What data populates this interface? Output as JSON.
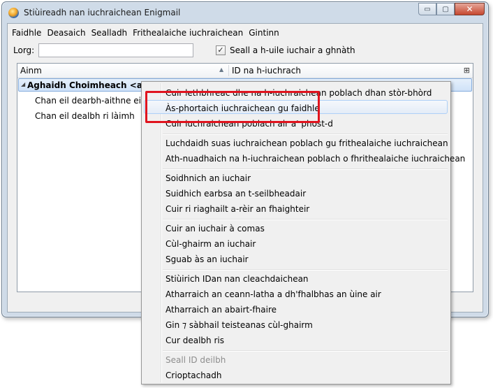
{
  "window": {
    "title": "Stiùireadh nan iuchraichean Enigmail",
    "buttons": {
      "minimize": "▭",
      "maximize": "▢",
      "close": "✕"
    }
  },
  "menubar": {
    "items": [
      {
        "label": "Faidhle"
      },
      {
        "label": "Deasaich"
      },
      {
        "label": "Sealladh"
      },
      {
        "label": "Frithealaiche iuchraichean"
      },
      {
        "label": "Gintinn"
      }
    ]
  },
  "search": {
    "label": "Lorg:",
    "value": "",
    "icon": "search-icon"
  },
  "show_all": {
    "checked": true,
    "check_glyph": "✓",
    "label": "Seall a h-uile iuchair a ghnàth"
  },
  "tree": {
    "columns": [
      {
        "label": "Ainm"
      },
      {
        "label": "ID na h-iuchrach"
      }
    ],
    "column_picker_glyph": "⊞",
    "rows": [
      {
        "text": "Aghaidh Choimheach <aghaidh",
        "expanded": true,
        "twisty": "◢"
      },
      {
        "text": "Chan eil dearbh-aithne eile aig"
      },
      {
        "text": "Chan eil dealbh ri làimh"
      }
    ]
  },
  "context_menu": {
    "groups": [
      [
        {
          "label": "Cuir lethbhreac dhe na h-iuchraichean poblach dhan stòr-bhòrd"
        },
        {
          "label": "Às-phortaich iuchraichean gu faidhle",
          "highlighted": true
        },
        {
          "label": "Cuir iuchraichean poblach air a' phost-d"
        }
      ],
      [
        {
          "label": "Luchdaidh suas iuchraichean poblach gu frithealaiche iuchraichean"
        },
        {
          "label": "Ath-nuadhaich na h-iuchraichean poblach o fhrithealaiche iuchraichean"
        }
      ],
      [
        {
          "label": "Soidhnich an iuchair"
        },
        {
          "label": "Suidhich earbsa an t-seilbheadair"
        },
        {
          "label": "Cuir ri riaghailt a-rèir an fhaighteir"
        }
      ],
      [
        {
          "label": "Cuir an iuchair à comas"
        },
        {
          "label": "Cùl-ghairm an iuchair"
        },
        {
          "label": "Sguab às an iuchair"
        }
      ],
      [
        {
          "label": "Stiùirich IDan nan cleachdaichean"
        },
        {
          "label": "Atharraich an ceann-latha a dh'fhalbhas an ùine air"
        },
        {
          "label": "Atharraich an abairt-fhaire"
        },
        {
          "label": "Gin ⁊ sàbhail teisteanas cùl-ghairm"
        },
        {
          "label": "Cur dealbh ris"
        }
      ],
      [
        {
          "label": "Seall ID deilbh",
          "disabled": true
        },
        {
          "label": "Crioptachadh"
        }
      ]
    ]
  },
  "colors": {
    "annotation": "#e0141e",
    "selection": "#cfe2f8",
    "menu_bg": "#f0f0f0"
  }
}
